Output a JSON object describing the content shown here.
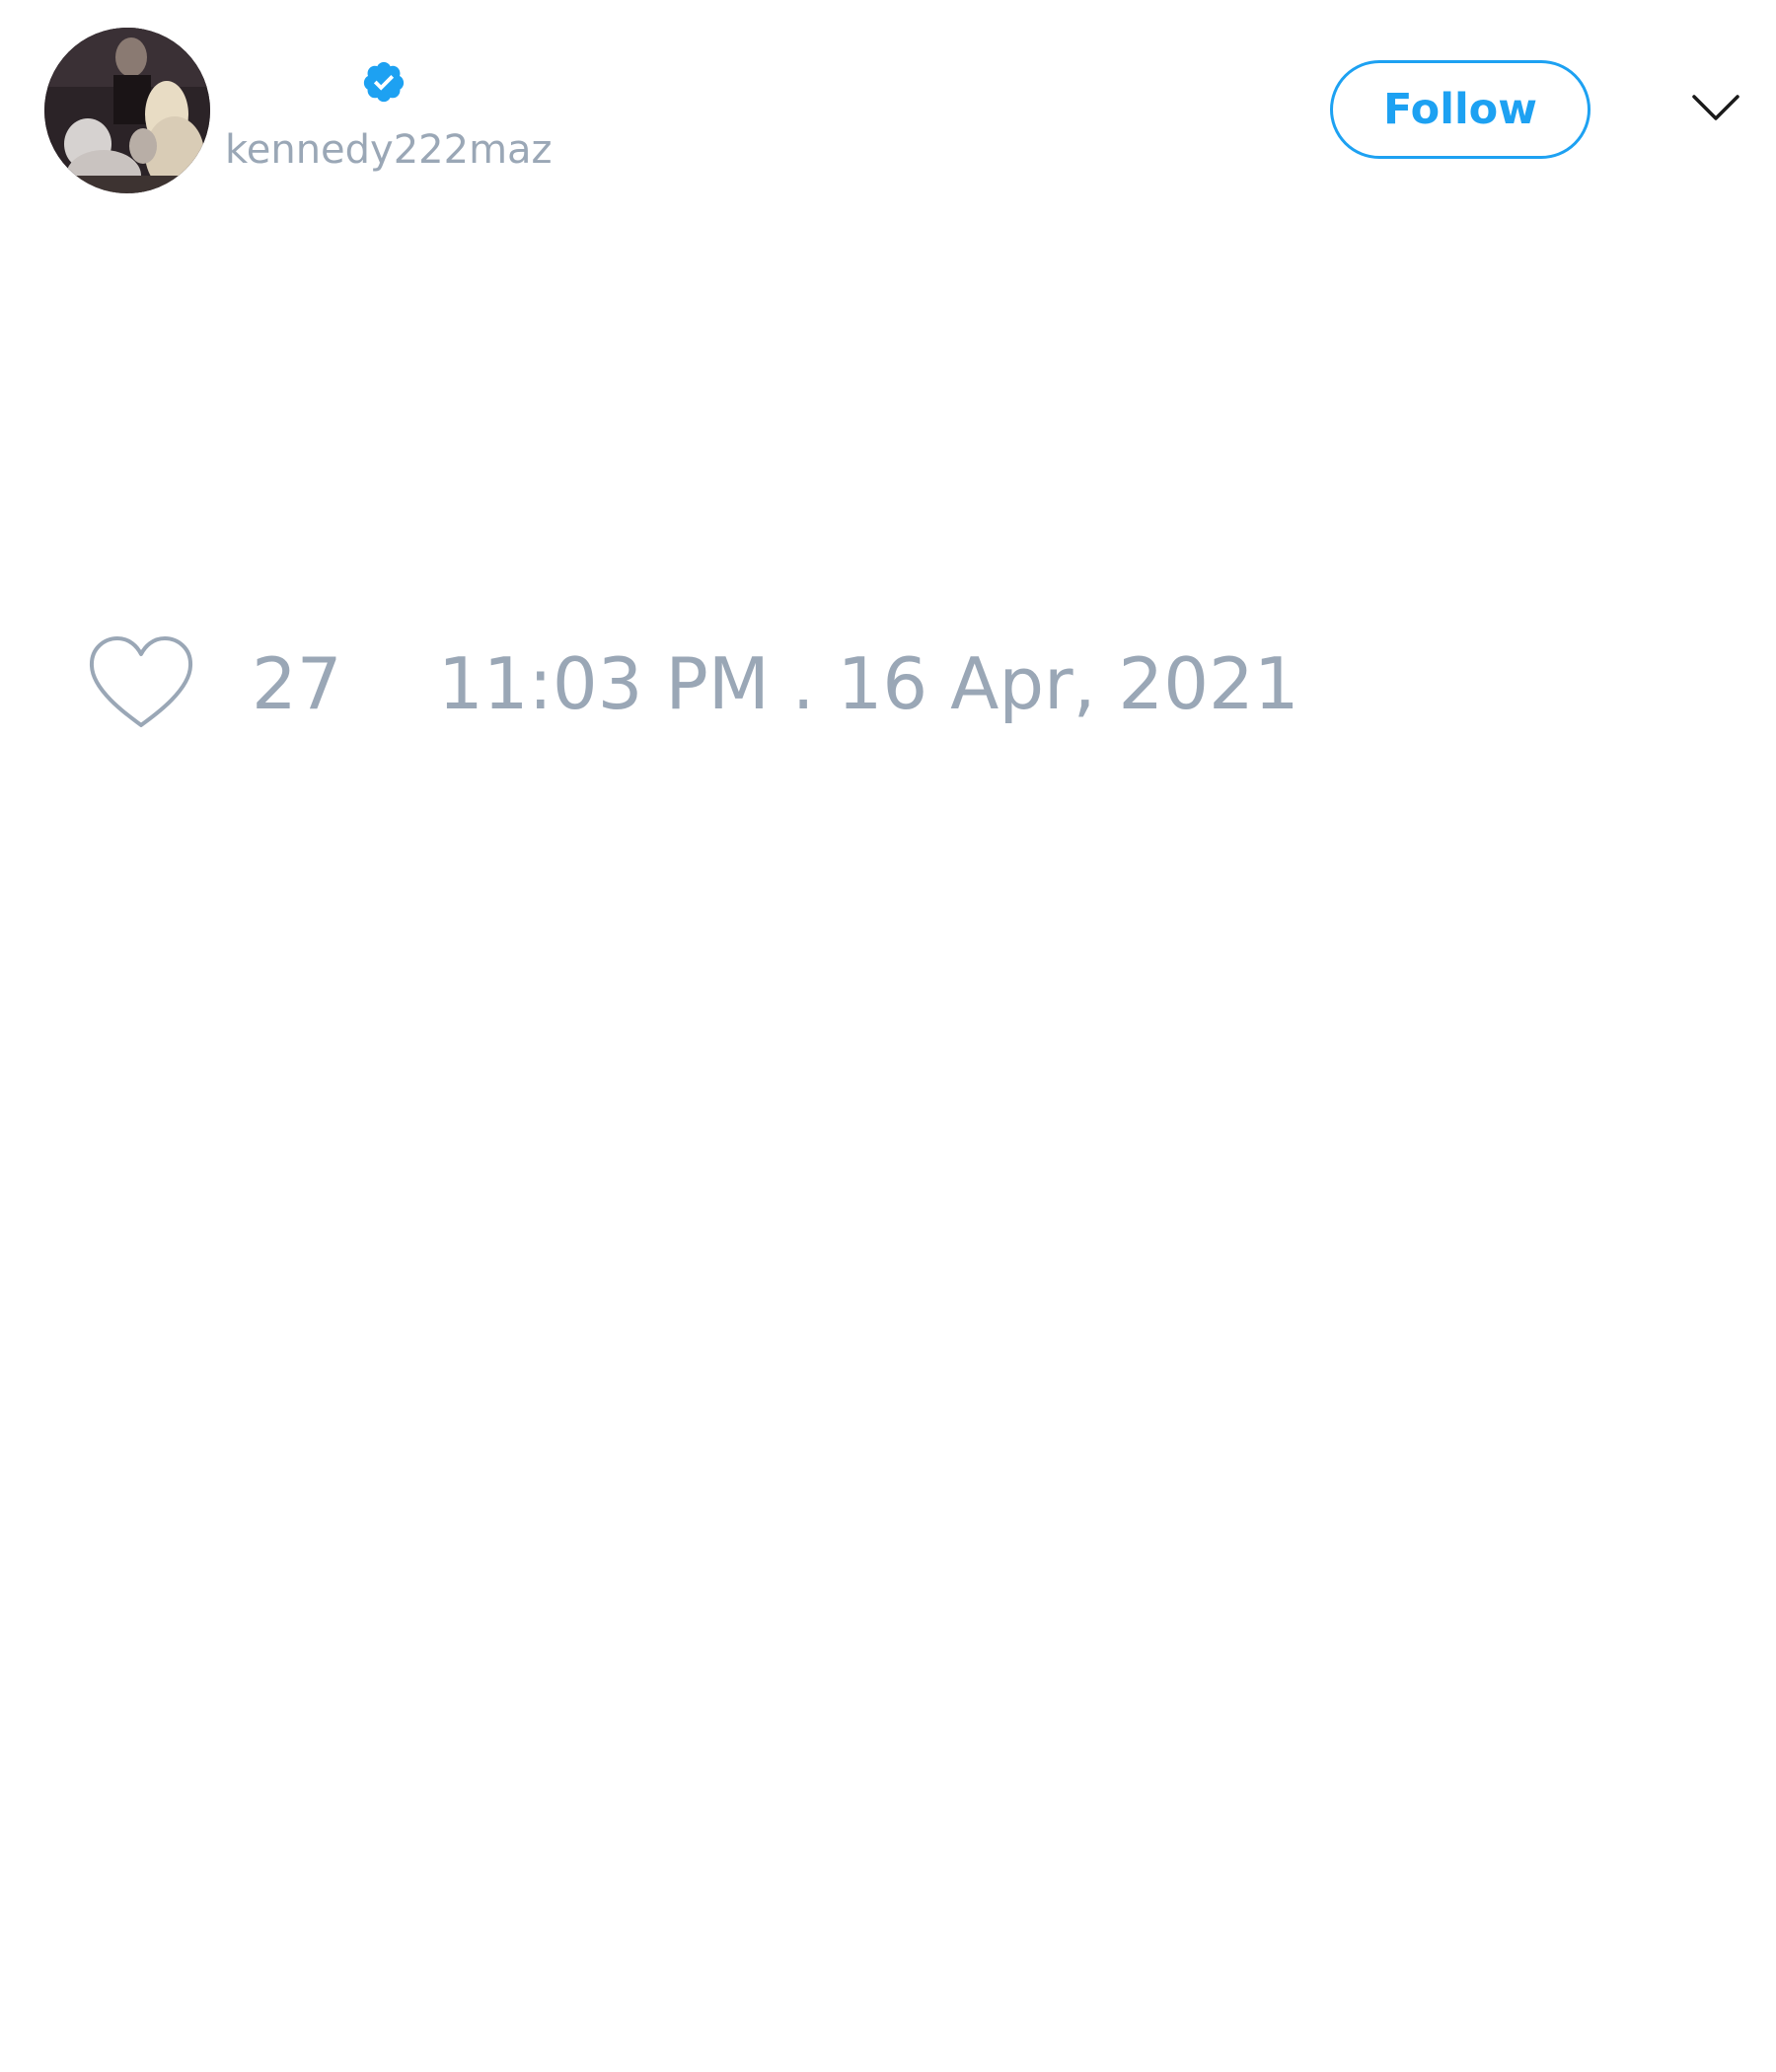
{
  "author": {
    "handle": "kennedy222maz",
    "verified": true,
    "avatar_icon": "profile-photo"
  },
  "header": {
    "follow_label": "Follow",
    "menu_icon": "chevron-down-icon"
  },
  "engagement": {
    "like_icon": "heart-outline-icon",
    "like_count": "27",
    "timestamp": "11:03 PM . 16 Apr, 2021"
  },
  "colors": {
    "accent": "#1da1f2",
    "muted_text": "#9aa7b6",
    "background": "#ffffff"
  }
}
